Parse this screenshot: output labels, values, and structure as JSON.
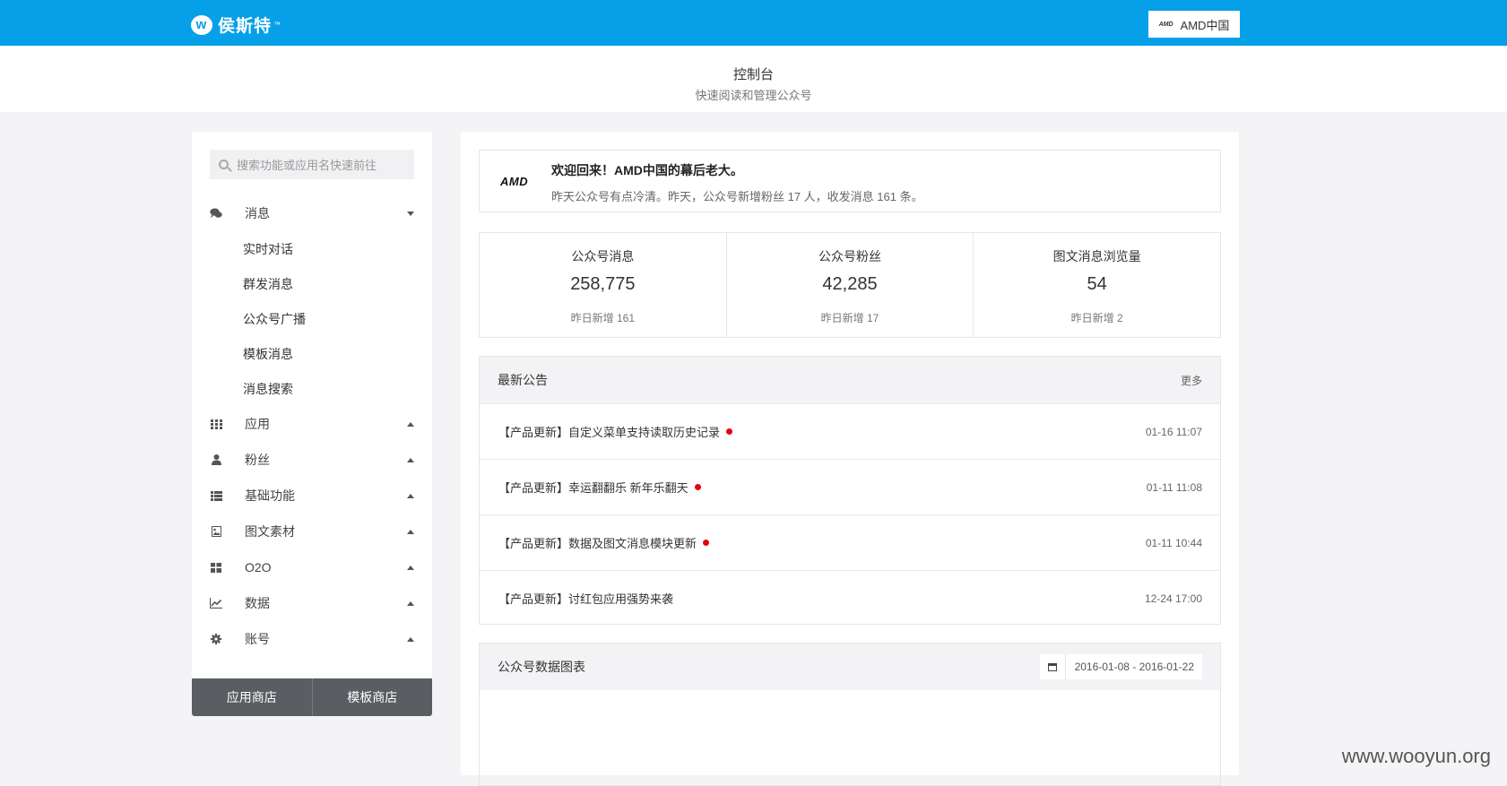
{
  "header": {
    "logo_mark": "w",
    "logo_text": "侯斯特",
    "logo_tm": "™",
    "account_mini_logo": "AMD",
    "account_name": "AMD中国"
  },
  "page": {
    "title": "控制台",
    "subtitle": "快速阅读和管理公众号"
  },
  "sidebar": {
    "search_placeholder": "搜索功能或应用名快速前往",
    "menu": [
      {
        "label": "消息",
        "icon": "chat-icon",
        "expanded": true,
        "children": [
          "实时对话",
          "群发消息",
          "公众号广播",
          "模板消息",
          "消息搜索"
        ]
      },
      {
        "label": "应用",
        "icon": "apps-grid-icon",
        "expanded": false
      },
      {
        "label": "粉丝",
        "icon": "user-icon",
        "expanded": false
      },
      {
        "label": "基础功能",
        "icon": "list-icon",
        "expanded": false
      },
      {
        "label": "图文素材",
        "icon": "image-icon",
        "expanded": false
      },
      {
        "label": "O2O",
        "icon": "blocks-icon",
        "expanded": false
      },
      {
        "label": "数据",
        "icon": "chart-icon",
        "expanded": false
      },
      {
        "label": "账号",
        "icon": "gear-icon",
        "expanded": false
      }
    ],
    "store_buttons": [
      "应用商店",
      "模板商店"
    ]
  },
  "welcome": {
    "logo": "AMD",
    "title": "欢迎回来！AMD中国的幕后老大。",
    "text": "昨天公众号有点冷清。昨天，公众号新增粉丝 17 人，收发消息 161 条。"
  },
  "stats": [
    {
      "label": "公众号消息",
      "value": "258,775",
      "sub": "昨日新增 161"
    },
    {
      "label": "公众号粉丝",
      "value": "42,285",
      "sub": "昨日新增 17"
    },
    {
      "label": "图文消息浏览量",
      "value": "54",
      "sub": "昨日新增 2"
    }
  ],
  "notices": {
    "title": "最新公告",
    "more": "更多",
    "items": [
      {
        "title": "【产品更新】自定义菜单支持读取历史记录",
        "date": "01-16 11:07",
        "unread": true
      },
      {
        "title": "【产品更新】幸运翻翻乐 新年乐翻天",
        "date": "01-11 11:08",
        "unread": true
      },
      {
        "title": "【产品更新】数据及图文消息模块更新",
        "date": "01-11 10:44",
        "unread": true
      },
      {
        "title": "【产品更新】讨红包应用强势来袭",
        "date": "12-24 17:00",
        "unread": false
      }
    ]
  },
  "chart_panel": {
    "title": "公众号数据图表",
    "date_range": "2016-01-08 - 2016-01-22"
  },
  "watermark": "www.wooyun.org",
  "colors": {
    "brand_blue": "#06a0e8",
    "unread_dot": "#e60012",
    "store_bar": "#5a5d61"
  }
}
